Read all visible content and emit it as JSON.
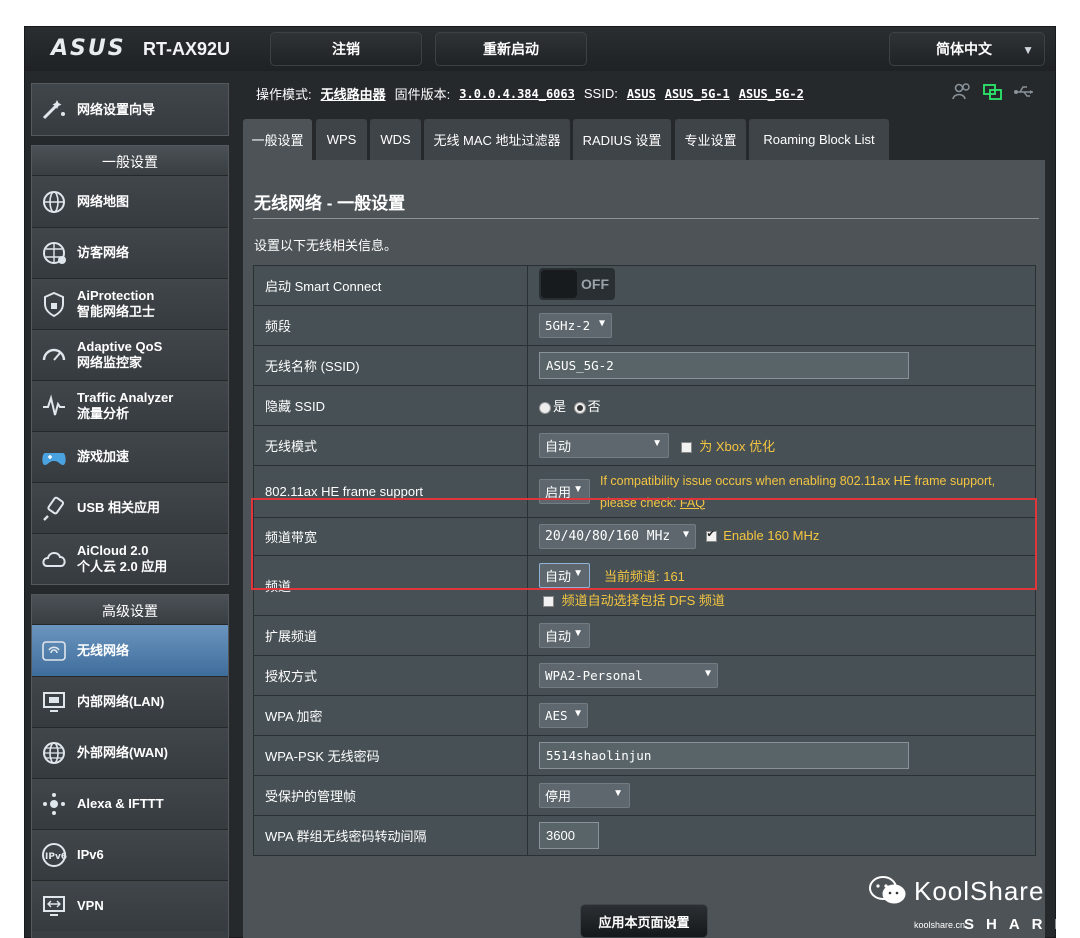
{
  "header": {
    "brand": "ASUS",
    "model": "RT-AX92U",
    "logout_label": "注销",
    "reboot_label": "重新启动",
    "language": "简体中文"
  },
  "sidebar": {
    "wizard": "网络设置向导",
    "general_heading": "一般设置",
    "general_items": [
      {
        "line1": "网络地图",
        "line2": ""
      },
      {
        "line1": "访客网络",
        "line2": ""
      },
      {
        "line1": "AiProtection",
        "line2": "智能网络卫士"
      },
      {
        "line1": "Adaptive QoS",
        "line2": "网络监控家"
      },
      {
        "line1": "Traffic Analyzer",
        "line2": "流量分析"
      },
      {
        "line1": "游戏加速",
        "line2": ""
      },
      {
        "line1": "USB 相关应用",
        "line2": ""
      },
      {
        "line1": "AiCloud 2.0",
        "line2": "个人云 2.0 应用"
      }
    ],
    "advanced_heading": "高级设置",
    "advanced_items": [
      {
        "line1": "无线网络"
      },
      {
        "line1": "内部网络(LAN)"
      },
      {
        "line1": "外部网络(WAN)"
      },
      {
        "line1": "Alexa & IFTTT"
      },
      {
        "line1": "IPv6"
      },
      {
        "line1": "VPN"
      }
    ]
  },
  "infoline": {
    "mode_label": "操作模式:",
    "mode_value": "无线路由器",
    "fw_label": "固件版本:",
    "fw_value": "3.0.0.4.384_6063",
    "ssid_label": "SSID:",
    "ssids": [
      "ASUS",
      "ASUS_5G-1",
      "ASUS_5G-2"
    ]
  },
  "tabs": [
    "一般设置",
    "WPS",
    "WDS",
    "无线 MAC 地址过滤器",
    "RADIUS 设置",
    "专业设置",
    "Roaming Block List"
  ],
  "content": {
    "title": "无线网络 - 一般设置",
    "description": "设置以下无线相关信息。",
    "apply_label": "应用本页面设置",
    "rows": {
      "smart_connect": {
        "label": "启动 Smart Connect",
        "value": "OFF"
      },
      "band": {
        "label": "频段",
        "value": "5GHz-2"
      },
      "ssid": {
        "label": "无线名称 (SSID)",
        "value": "ASUS_5G-2"
      },
      "hide_ssid": {
        "label": "隐藏 SSID",
        "yes": "是",
        "no": "否"
      },
      "wireless_mode": {
        "label": "无线模式",
        "value": "自动",
        "xbox": "为 Xbox 优化"
      },
      "he_frame": {
        "label": "802.11ax HE frame support",
        "value": "启用",
        "note1": "If compatibility issue occurs when enabling 802.11ax HE frame support,",
        "note2": "please check: ",
        "faq": "FAQ"
      },
      "bandwidth": {
        "label": "频道带宽",
        "value": "20/40/80/160 MHz",
        "enable160": "Enable 160 MHz"
      },
      "channel": {
        "label": "频道",
        "value": "自动",
        "current": "当前频道: 161",
        "dfs": "频道自动选择包括 DFS 频道"
      },
      "ext_channel": {
        "label": "扩展频道",
        "value": "自动"
      },
      "auth": {
        "label": "授权方式",
        "value": "WPA2-Personal"
      },
      "wpa_enc": {
        "label": "WPA 加密",
        "value": "AES"
      },
      "psk": {
        "label": "WPA-PSK 无线密码",
        "value": "5514shaolinjun"
      },
      "pmf": {
        "label": "受保护的管理帧",
        "value": "停用"
      },
      "group_key": {
        "label": "WPA 群组无线密码转动间隔",
        "value": "3600"
      }
    }
  },
  "watermark": {
    "main": "KoolShare",
    "sub": "koolshare.cn",
    "share": "SHARE"
  },
  "colors": {
    "accent_yellow": "#f4c541",
    "highlight_red": "#e0353a",
    "active_blue": "#4f7fae"
  }
}
